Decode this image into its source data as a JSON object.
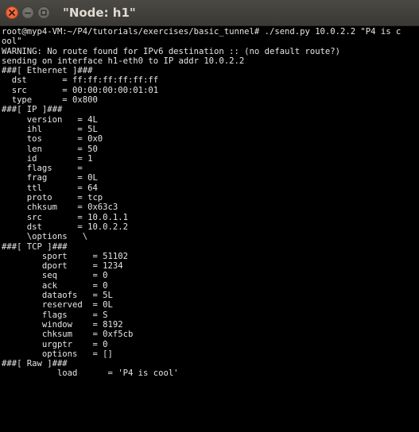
{
  "window": {
    "title": "\"Node: h1\"",
    "controls": [
      "close-icon",
      "minimize-icon",
      "maximize-icon"
    ],
    "colors": {
      "close": "#e05424",
      "titlebar": "#3f3e39",
      "background": "#000000",
      "text": "#e6e6e6"
    }
  },
  "terminal": {
    "lines": [
      "root@myp4-VM:~/P4/tutorials/exercises/basic_tunnel# ./send.py 10.0.2.2 \"P4 is c",
      "ool\"",
      "WARNING: No route found for IPv6 destination :: (no default route?)",
      "sending on interface h1-eth0 to IP addr 10.0.2.2",
      "###[ Ethernet ]###",
      "  dst       = ff:ff:ff:ff:ff:ff",
      "  src       = 00:00:00:00:01:01",
      "  type      = 0x800",
      "###[ IP ]###",
      "     version   = 4L",
      "     ihl       = 5L",
      "     tos       = 0x0",
      "     len       = 50",
      "     id        = 1",
      "     flags     = ",
      "     frag      = 0L",
      "     ttl       = 64",
      "     proto     = tcp",
      "     chksum    = 0x63c3",
      "     src       = 10.0.1.1",
      "     dst       = 10.0.2.2",
      "     \\options   \\",
      "###[ TCP ]###",
      "        sport     = 51102",
      "        dport     = 1234",
      "        seq       = 0",
      "        ack       = 0",
      "        dataofs   = 5L",
      "        reserved  = 0L",
      "        flags     = S",
      "        window    = 8192",
      "        chksum    = 0xf5cb",
      "        urgptr    = 0",
      "        options   = []",
      "###[ Raw ]###",
      "           load      = 'P4 is cool'",
      ""
    ]
  }
}
